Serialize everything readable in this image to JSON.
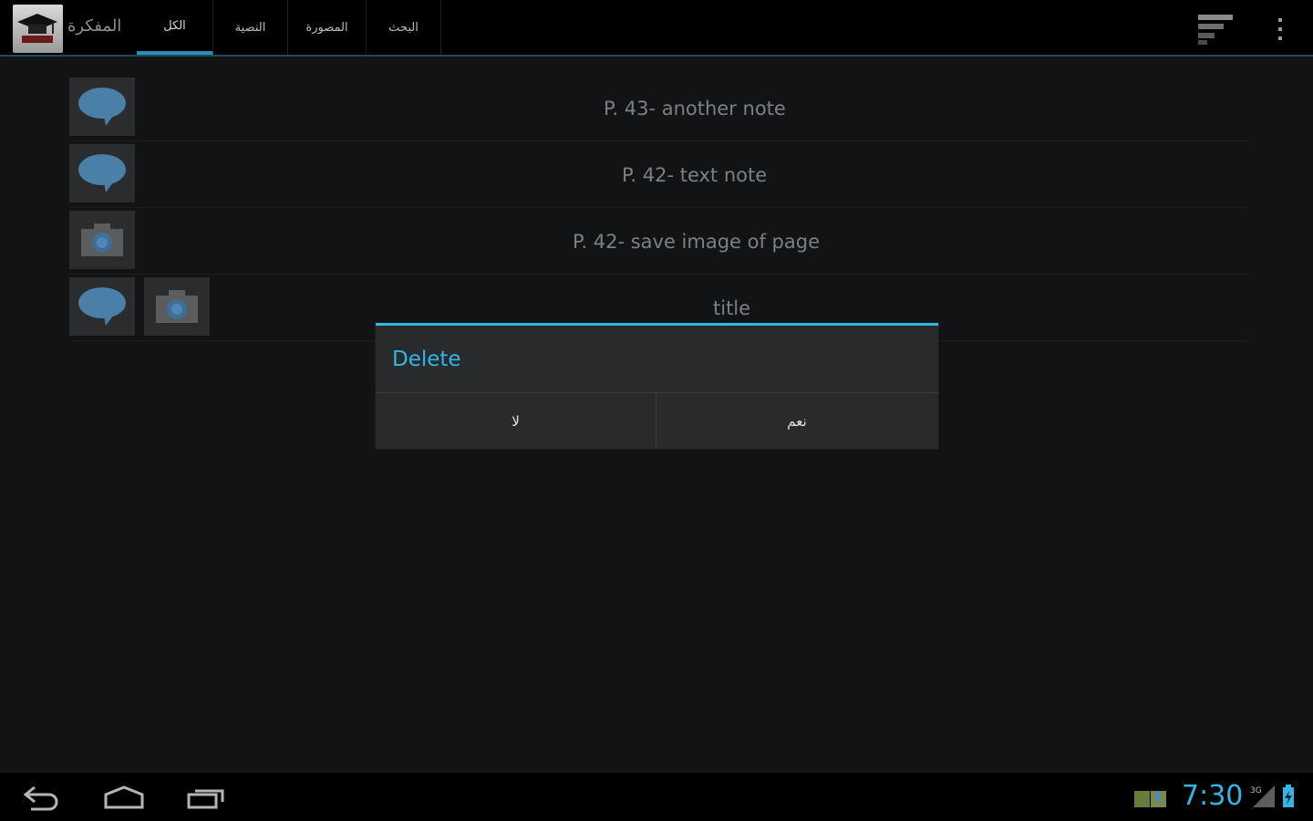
{
  "app": {
    "title": "المفكرة",
    "logo_icon": "graduation-cap-logo"
  },
  "tabs": [
    {
      "label": "الكل",
      "active": true
    },
    {
      "label": "النصية",
      "active": false
    },
    {
      "label": "المصورة",
      "active": false
    },
    {
      "label": "البحث",
      "active": false
    }
  ],
  "actions": {
    "sort_icon": "sort-icon",
    "overflow_icon": "overflow-menu-icon"
  },
  "notes": [
    {
      "label": "P. 43- another note",
      "icons": [
        "speech-bubble-icon"
      ]
    },
    {
      "label": "P. 42- text note",
      "icons": [
        "speech-bubble-icon"
      ]
    },
    {
      "label": "P. 42- save image of page",
      "icons": [
        "camera-icon"
      ]
    },
    {
      "label": "title",
      "icons": [
        "speech-bubble-icon",
        "camera-icon"
      ]
    }
  ],
  "dialog": {
    "title": "Delete",
    "negative_label": "لا",
    "positive_label": "نعم"
  },
  "status_bar": {
    "time": "7:30",
    "network_label": "3G",
    "accent": "#33b5e5"
  },
  "nav_icons": [
    "back-icon",
    "home-icon",
    "recent-apps-icon"
  ]
}
